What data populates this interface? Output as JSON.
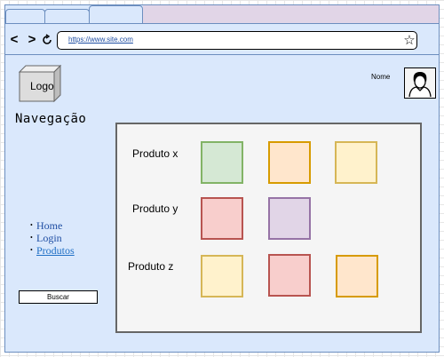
{
  "browser": {
    "tabs": [
      "",
      "",
      ""
    ],
    "back_icon": "chevron-left-icon",
    "forward_icon": "chevron-right-icon",
    "refresh_icon": "refresh-icon",
    "url": "https://www.site.com",
    "bookmark_icon": "star-icon",
    "colors": {
      "frame": "#dae8fc",
      "border": "#6c8ebf",
      "tabstrip": "#e1d5e7"
    }
  },
  "header": {
    "logo_label": "Logo",
    "user_name": "Nome",
    "avatar_icon": "user-icon"
  },
  "sidebar": {
    "title": "Navegação",
    "menu": [
      {
        "label": "Home"
      },
      {
        "label": "Login"
      },
      {
        "label": "Produtos"
      }
    ],
    "search_button": "Buscar"
  },
  "products": {
    "rows": [
      {
        "label": "Produto x",
        "tiles": [
          "green",
          "orange",
          "yellow"
        ]
      },
      {
        "label": "Produto y",
        "tiles": [
          "red",
          "purple"
        ]
      },
      {
        "label": "Produto z",
        "tiles": [
          "yellow",
          "red",
          "orange"
        ]
      }
    ],
    "colors": {
      "green": "#d5e8d4",
      "orange": "#ffe6cc",
      "yellow": "#fff2cc",
      "red": "#f8cecc",
      "purple": "#e1d5e7"
    }
  }
}
